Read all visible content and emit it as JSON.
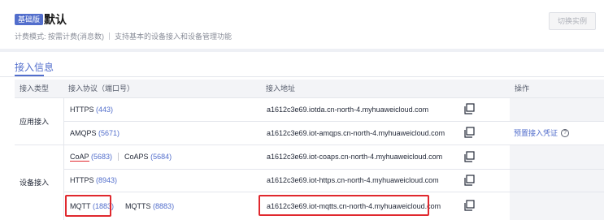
{
  "instance": {
    "edition_badge": "基础版",
    "name": "默认",
    "billing_mode": "计费模式: 按需计费(消息数)",
    "description": "支持基本的设备接入和设备管理功能",
    "switch_button": "切换实例"
  },
  "tab": {
    "label": "接入信息"
  },
  "table": {
    "headers": [
      "接入类型",
      "接入协议（端口号）",
      "接入地址",
      "操作"
    ],
    "groups": {
      "app": "应用接入",
      "device": "设备接入"
    },
    "rows": [
      {
        "protocols": [
          {
            "name": "HTTPS",
            "port": "(443)"
          }
        ],
        "address": "a1612c3e69.iotda.cn-north-4.myhuaweicloud.com",
        "action": ""
      },
      {
        "protocols": [
          {
            "name": "AMQPS",
            "port": "(5671)"
          }
        ],
        "address": "a1612c3e69.iot-amqps.cn-north-4.myhuaweicloud.com",
        "action": "预置接入凭证"
      },
      {
        "protocols": [
          {
            "name": "CoAP",
            "port": "(5683)"
          },
          {
            "name": "CoAPS",
            "port": "(5684)"
          }
        ],
        "address": "a1612c3e69.iot-coaps.cn-north-4.myhuaweicloud.com",
        "action": ""
      },
      {
        "protocols": [
          {
            "name": "HTTPS",
            "port": "(8943)"
          }
        ],
        "address": "a1612c3e69.iot-https.cn-north-4.myhuaweicloud.com",
        "action": ""
      },
      {
        "protocols": [
          {
            "name": "MQTT",
            "port": "(1883)"
          },
          {
            "name": "MQTTS",
            "port": "(8883)"
          }
        ],
        "address": "a1612c3e69.iot-mqtts.cn-north-4.myhuaweicloud.com",
        "action": ""
      }
    ],
    "help_icon_char": "?"
  },
  "colors": {
    "accent": "#526ecc",
    "highlight": "#e0282e"
  }
}
